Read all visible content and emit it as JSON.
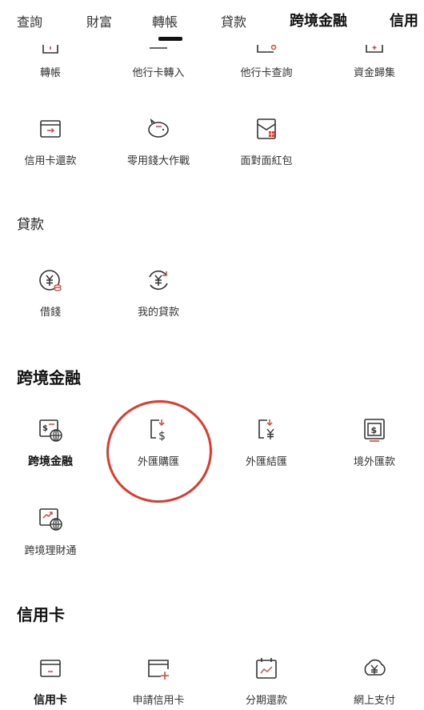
{
  "tabs": [
    {
      "label": "查詢"
    },
    {
      "label": "財富"
    },
    {
      "label": "轉帳"
    },
    {
      "label": "貸款"
    },
    {
      "label": "跨境金融",
      "active": true
    },
    {
      "label": "信用"
    }
  ],
  "transfer": {
    "items": [
      {
        "label": "轉帳",
        "icon": "transfer-icon"
      },
      {
        "label": "他行卡轉入",
        "icon": "card-in-icon"
      },
      {
        "label": "他行卡查詢",
        "icon": "card-search-icon"
      },
      {
        "label": "資金歸集",
        "icon": "fund-collect-icon"
      },
      {
        "label": "信用卡還款",
        "icon": "credit-repay-icon"
      },
      {
        "label": "零用錢大作戰",
        "icon": "piggy-bank-icon"
      },
      {
        "label": "面對面紅包",
        "icon": "red-envelope-icon"
      }
    ]
  },
  "loan": {
    "title": "貸款",
    "items": [
      {
        "label": "借錢",
        "icon": "borrow-yuan-icon"
      },
      {
        "label": "我的貸款",
        "icon": "loan-yuan-icon"
      }
    ]
  },
  "crossborder": {
    "title": "跨境金融",
    "items": [
      {
        "label": "跨境金融",
        "icon": "crossborder-globe-icon"
      },
      {
        "label": "外匯購匯",
        "icon": "fx-buy-icon"
      },
      {
        "label": "外匯結匯",
        "icon": "fx-settle-icon"
      },
      {
        "label": "境外匯款",
        "icon": "overseas-remit-icon"
      },
      {
        "label": "跨境理財通",
        "icon": "wealth-connect-icon"
      }
    ]
  },
  "creditcard": {
    "title": "信用卡",
    "items": [
      {
        "label": "信用卡",
        "icon": "credit-card-icon"
      },
      {
        "label": "申請信用卡",
        "icon": "apply-card-icon"
      },
      {
        "label": "分期還款",
        "icon": "installment-icon"
      },
      {
        "label": "網上支付",
        "icon": "online-pay-icon"
      }
    ]
  },
  "colors": {
    "accent": "#d9443a",
    "highlight_ring": "#e03a2e",
    "text": "#222222"
  }
}
